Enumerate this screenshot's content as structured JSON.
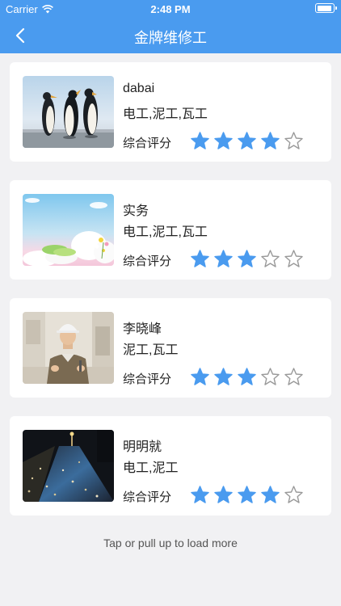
{
  "status": {
    "carrier": "Carrier",
    "time": "2:48 PM"
  },
  "nav": {
    "title": "金牌维修工"
  },
  "colors": {
    "accent": "#4a9bef",
    "star_filled": "#4a9bef",
    "star_empty": "#999999"
  },
  "rating_label": "综合评分",
  "workers": [
    {
      "name": "dabai",
      "skills": "电工,泥工,瓦工",
      "rating": 4,
      "max_rating": 5,
      "photo": "penguins-photo"
    },
    {
      "name": "实务",
      "skills": "电工,泥工,瓦工",
      "rating": 3,
      "max_rating": 5,
      "photo": "sky-clouds-illustration"
    },
    {
      "name": "李晓峰",
      "skills": "泥工,瓦工",
      "rating": 3,
      "max_rating": 5,
      "photo": "worker-portrait-photo"
    },
    {
      "name": "明明就",
      "skills": "电工,泥工",
      "rating": 4,
      "max_rating": 5,
      "photo": "night-street-photo"
    }
  ],
  "footer": {
    "load_more": "Tap or pull up to load more"
  }
}
